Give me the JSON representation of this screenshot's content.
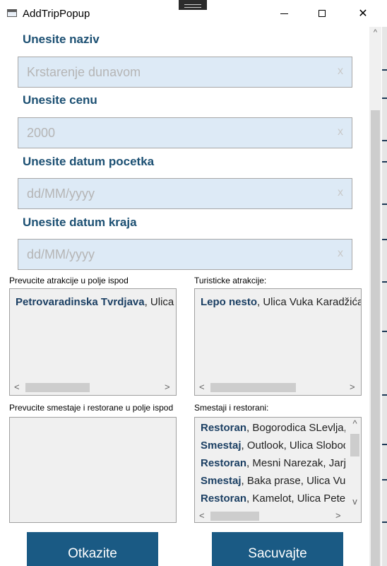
{
  "window": {
    "title": "AddTripPopup",
    "controls": {
      "minimize": "",
      "maximize": "",
      "close": "✕"
    }
  },
  "form": {
    "name": {
      "label": "Unesite naziv",
      "placeholder": "Krstarenje dunavom"
    },
    "price": {
      "label": "Unesite cenu",
      "placeholder": "2000"
    },
    "start_date": {
      "label": "Unesite datum pocetka",
      "placeholder": "dd/MM/yyyy"
    },
    "end_date": {
      "label": "Unesite datum kraja",
      "placeholder": "dd/MM/yyyy"
    },
    "clear_glyph": "x"
  },
  "attractions": {
    "drop_label": "Prevucite atrakcije u polje ispod",
    "drop_items": [
      {
        "type": "Petrovaradinska Tvrdjava",
        "rest": ", Ulica Tr"
      }
    ],
    "source_label": "Turisticke atrakcije:",
    "source_items": [
      {
        "type": "Lepo nesto",
        "rest": ", Ulica Vuka Karadžića"
      }
    ]
  },
  "accommodation": {
    "drop_label": "Prevucite smestaje i restorane u polje ispod",
    "source_label": "Smestaji i restorani:",
    "source_items": [
      {
        "type": "Restoran",
        "rest": ", Bogorodica SLevlja, U"
      },
      {
        "type": "Smestaj",
        "rest": ", Outlook, Ulica Slobodana"
      },
      {
        "type": "Restoran",
        "rest": ", Mesni Narezak, Jarje"
      },
      {
        "type": "Smestaj",
        "rest": ", Baka prase, Ulica Vuka"
      },
      {
        "type": "Restoran",
        "rest": ", Kamelot, Ulica Petefi"
      }
    ]
  },
  "scroll_glyphs": {
    "left": "<",
    "right": ">",
    "up": "^",
    "down": "v"
  },
  "buttons": {
    "cancel": "Otkazite",
    "save": "Sacuvajte"
  }
}
